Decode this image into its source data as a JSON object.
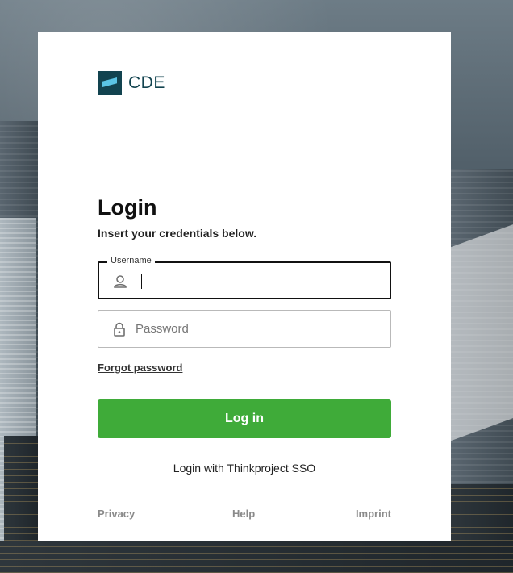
{
  "brand": {
    "name": "CDE",
    "mark_color": "#12434f",
    "accent_color": "#5bc4e4"
  },
  "login": {
    "title": "Login",
    "subtitle": "Insert your credentials below.",
    "username": {
      "label": "Username",
      "value": "",
      "icon": "user-icon"
    },
    "password": {
      "placeholder": "Password",
      "value": "",
      "icon": "lock-icon"
    },
    "forgot_password": "Forgot password",
    "submit_label": "Log in",
    "submit_color": "#3fab39",
    "sso_label": "Login with Thinkproject SSO"
  },
  "footer": {
    "privacy": "Privacy",
    "help": "Help",
    "imprint": "Imprint"
  }
}
